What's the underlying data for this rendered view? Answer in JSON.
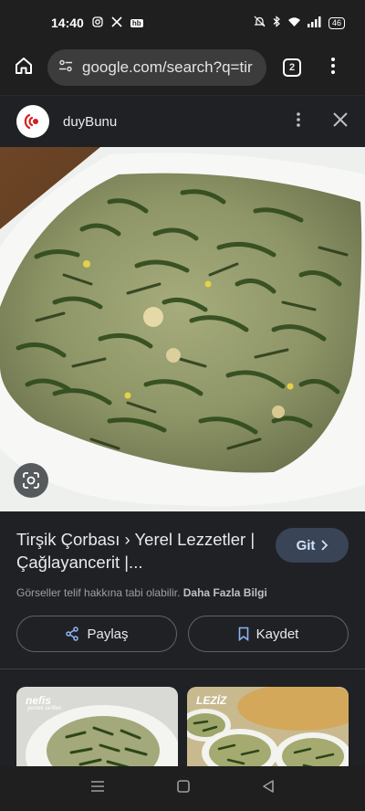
{
  "status_bar": {
    "time": "14:40",
    "left_icons": [
      "instagram-icon",
      "x-icon",
      "hb-icon"
    ],
    "hb_label": "hb",
    "battery": "46"
  },
  "browser": {
    "url": "google.com/search?q=tir",
    "tab_count": "2"
  },
  "header": {
    "site_name": "duyBunu"
  },
  "result": {
    "title": "Tirşik Çorbası › Yerel Lezzetler | Çağlayancerit |...",
    "go_label": "Git",
    "copyright_text": "Görseller telif hakkına tabi olabilir.",
    "more_info": "Daha Fazla Bilgi",
    "share_label": "Paylaş",
    "save_label": "Kaydet"
  },
  "related": [
    {
      "label": "nefis",
      "sub": "yemek tarifleri"
    },
    {
      "label": "LEZİZ",
      "sub": ""
    }
  ],
  "colors": {
    "background": "#1f1f1f",
    "card": "#202124",
    "accent_button": "#394457",
    "accent_text": "#d2e3fc",
    "logo_red": "#d6201f"
  }
}
